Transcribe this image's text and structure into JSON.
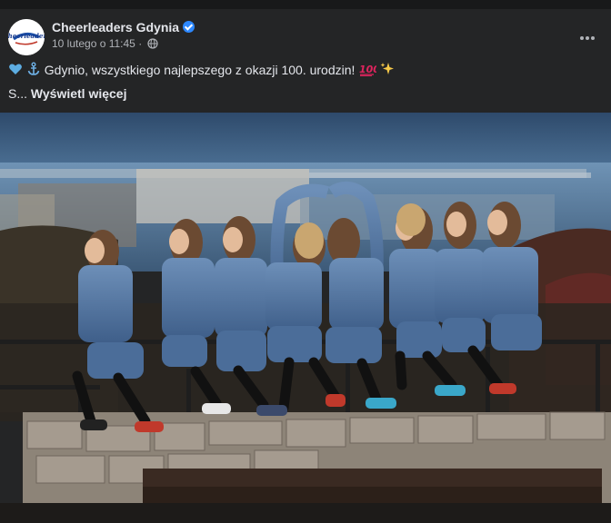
{
  "post": {
    "page_name": "Cheerleaders Gdynia",
    "avatar_text": "Cheerleaders",
    "timestamp": "10 lutego o 11:45",
    "separator": "·",
    "more_icon": "more-options-icon",
    "text": "Gdynio, wszystkiego najlepszego z okazji 100. urodzin!",
    "emoji_before": [
      "blue-heart-icon",
      "anchor-icon"
    ],
    "emoji_after": [
      "hundred-points-icon",
      "sparkles-icon"
    ],
    "see_more_prefix": "S...",
    "see_more_label": "Wyświetl więcej"
  },
  "colors": {
    "background": "#242526",
    "text": "#e4e6eb",
    "secondary": "#b0b3b8",
    "verified": "#2d88ff"
  }
}
